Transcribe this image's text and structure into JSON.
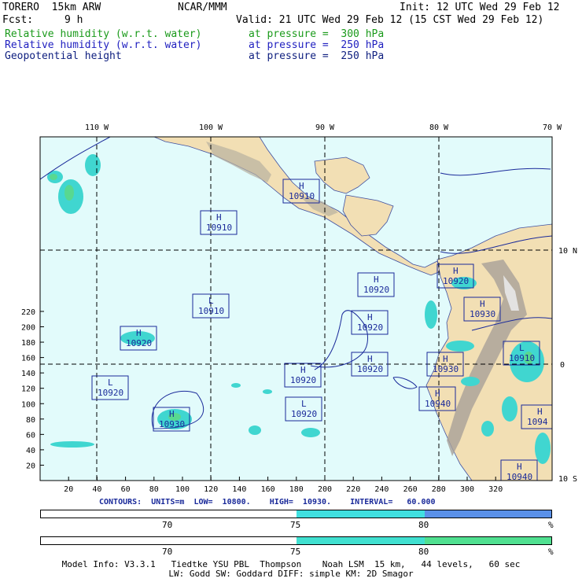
{
  "header": {
    "model": "TORERO  15km ARW",
    "center": "NCAR/MMM",
    "init": "Init: 12 UTC Wed 29 Feb 12",
    "fcst_label": "Fcst:",
    "fcst_value": "9 h",
    "valid": "Valid: 21 UTC Wed 29 Feb 12 (15 CST Wed 29 Feb 12)"
  },
  "fields": [
    {
      "name": "Relative humidity (w.r.t. water)",
      "level": "at pressure =  300 hPa",
      "color": "#1a9a1a"
    },
    {
      "name": "Relative humidity (w.r.t. water)",
      "level": "at pressure =  250 hPa",
      "color": "#2020c0"
    },
    {
      "name": "Geopotential height",
      "level": "at pressure =  250 hPa",
      "color": "#102080"
    }
  ],
  "map": {
    "lon_labels": [
      "110 W",
      "100 W",
      "90 W",
      "80 W",
      "70 W"
    ],
    "lat_labels": [
      "10 N",
      "0",
      "10 S"
    ],
    "x_ticks": [
      "20",
      "40",
      "60",
      "80",
      "100",
      "120",
      "140",
      "160",
      "180",
      "200",
      "220",
      "240",
      "260",
      "280",
      "300",
      "320"
    ],
    "y_ticks": [
      "20",
      "40",
      "60",
      "80",
      "100",
      "120",
      "140",
      "160",
      "180",
      "200",
      "220"
    ],
    "colors": {
      "ocean": "#e2fbfb",
      "land": "#f2dfb4",
      "rh": "#40d6d0",
      "rh_green": "#58d890",
      "boxes": "#1a2a9a"
    },
    "centers": [
      {
        "type": "H",
        "value": "10910"
      },
      {
        "type": "H",
        "value": "10910"
      },
      {
        "type": "L",
        "value": "10910"
      },
      {
        "type": "H",
        "value": "10920"
      },
      {
        "type": "H",
        "value": "10920"
      },
      {
        "type": "H",
        "value": "10920"
      },
      {
        "type": "H",
        "value": "10920"
      },
      {
        "type": "H",
        "value": "10930"
      },
      {
        "type": "H",
        "value": "10920"
      },
      {
        "type": "L",
        "value": "10920"
      },
      {
        "type": "H",
        "value": "10930"
      },
      {
        "type": "H",
        "value": "10920"
      },
      {
        "type": "L",
        "value": "10920"
      },
      {
        "type": "H",
        "value": "10930"
      },
      {
        "type": "L",
        "value": "10910"
      },
      {
        "type": "H",
        "value": "10940"
      },
      {
        "type": "H",
        "value": "1094"
      },
      {
        "type": "H",
        "value": "10940"
      }
    ]
  },
  "contours": {
    "label": "CONTOURS:",
    "units": "UNITS=m",
    "low": "LOW=  10800.",
    "high": "HIGH=  10930.",
    "interval": "INTERVAL=   60.000"
  },
  "colorbars": [
    {
      "labels": [
        "70",
        "75",
        "80"
      ],
      "unit": "%",
      "colors": [
        "#ffffff",
        "#40e0e0",
        "#5a90e8"
      ]
    },
    {
      "labels": [
        "70",
        "75",
        "80"
      ],
      "unit": "%",
      "colors": [
        "#ffffff",
        "#40e0d0",
        "#50e090"
      ]
    }
  ],
  "footer": {
    "line1": "Model Info: V3.3.1   Tiedtke YSU PBL  Thompson    Noah LSM  15 km,   44 levels,   60 sec",
    "line2": "LW: Godd SW: Goddard DIFF: simple KM: 2D Smagor"
  }
}
